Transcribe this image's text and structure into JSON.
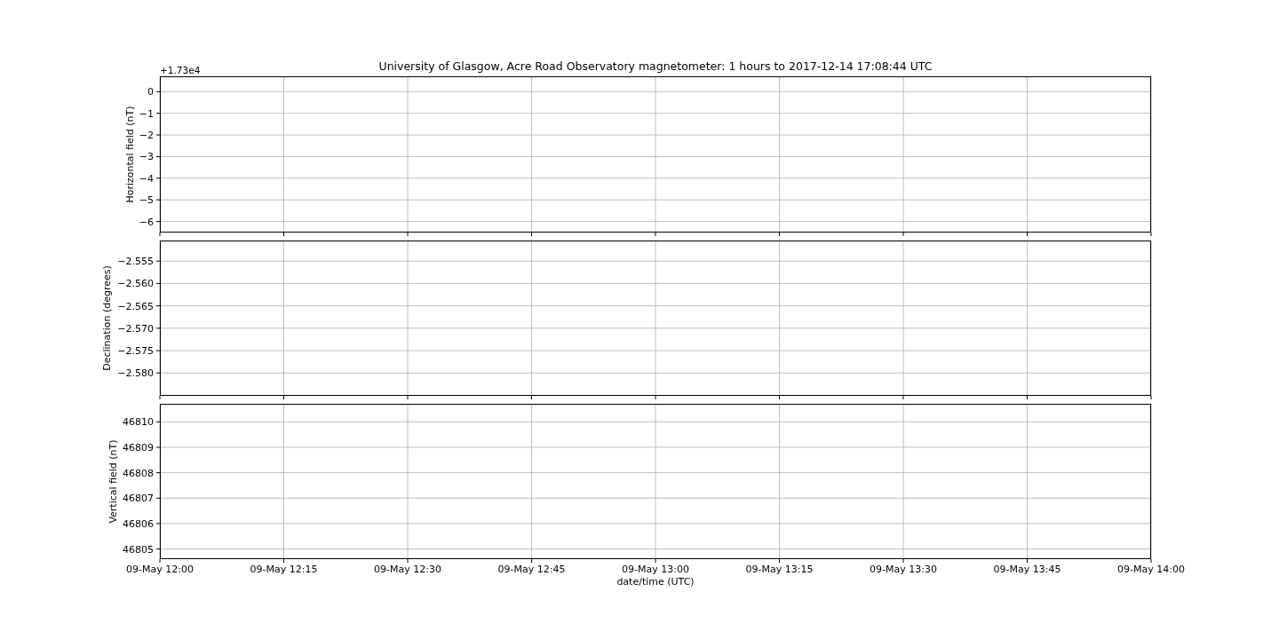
{
  "figure": {
    "title": "University of Glasgow, Acre Road Observatory magnetometer: 1 hours to 2017-12-14 17:08:44 UTC",
    "offset_text": "+1.73e4",
    "panels": [
      {
        "chart_data": {
          "type": "line",
          "grid": true,
          "ylabel": "Horizontal field (nT)",
          "ylim": [
            -6.49,
            0.69
          ],
          "yticks": [
            {
              "value": 0,
              "label": "0"
            },
            {
              "value": -1,
              "label": "−1"
            },
            {
              "value": -2,
              "label": "−2"
            },
            {
              "value": -3,
              "label": "−3"
            },
            {
              "value": -4,
              "label": "−4"
            },
            {
              "value": -5,
              "label": "−5"
            },
            {
              "value": -6,
              "label": "−6"
            }
          ],
          "categories": [
            null,
            null,
            null,
            null,
            null,
            null,
            null,
            null,
            null
          ]
        }
      },
      {
        "chart_data": {
          "type": "line",
          "grid": true,
          "ylabel": "Declination (degrees)",
          "ylim": [
            -2.585,
            -2.5505
          ],
          "yticks": [
            {
              "value": -2.555,
              "label": "−2.555"
            },
            {
              "value": -2.56,
              "label": "−2.560"
            },
            {
              "value": -2.565,
              "label": "−2.565"
            },
            {
              "value": -2.57,
              "label": "−2.570"
            },
            {
              "value": -2.575,
              "label": "−2.575"
            },
            {
              "value": -2.58,
              "label": "−2.580"
            }
          ],
          "categories": [
            null,
            null,
            null,
            null,
            null,
            null,
            null,
            null,
            null
          ]
        }
      },
      {
        "chart_data": {
          "type": "line",
          "grid": true,
          "ylabel": "Vertical field (nT)",
          "xlabel": "date/time (UTC)",
          "ylim": [
            46804.62,
            46810.69
          ],
          "yticks": [
            46810,
            46809,
            46808,
            46807,
            46806,
            46805
          ],
          "categories": [
            "09-May 12:00",
            "09-May 12:15",
            "09-May 12:30",
            "09-May 12:45",
            "09-May 13:00",
            "09-May 13:15",
            "09-May 13:30",
            "09-May 13:45",
            "09-May 14:00"
          ]
        }
      }
    ]
  }
}
